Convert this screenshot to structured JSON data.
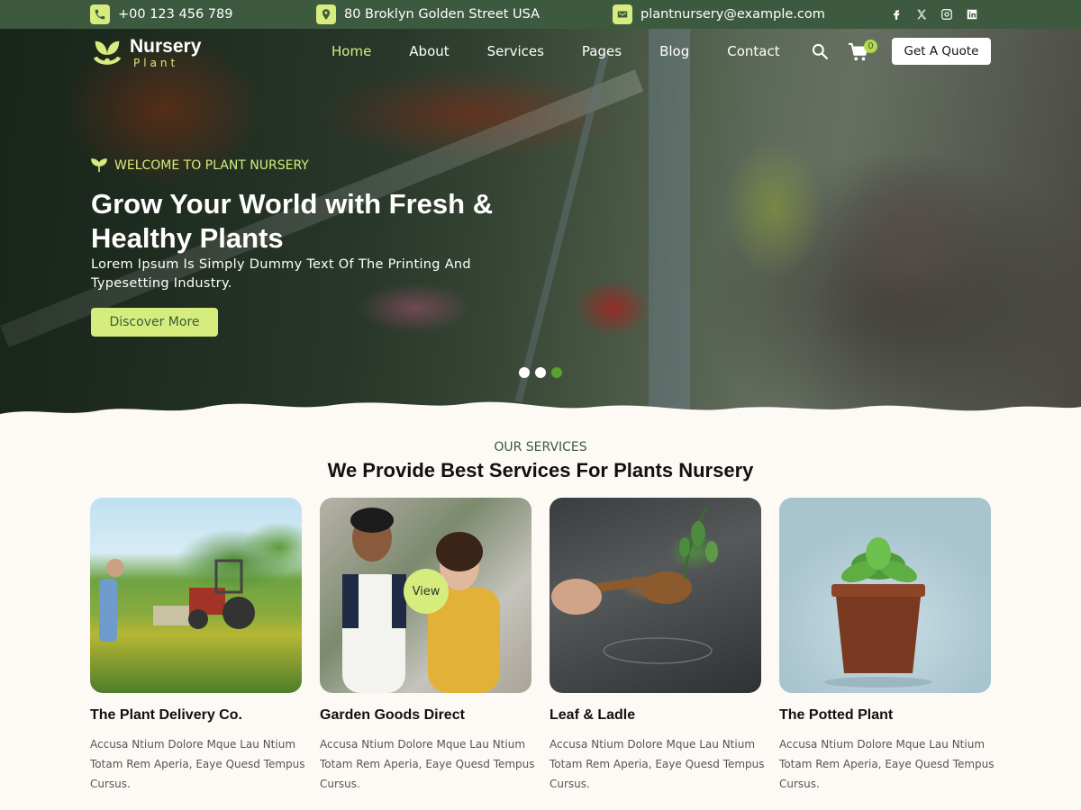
{
  "topbar": {
    "phone": "+00 123 456 789",
    "address": "80 Broklyn Golden Street USA",
    "email": "plantnursery@example.com",
    "socials": [
      "facebook-icon",
      "x-icon",
      "instagram-icon",
      "linkedin-icon"
    ]
  },
  "header": {
    "logo_line1": "Nursery",
    "logo_line2": "Plant",
    "nav": [
      "Home",
      "About",
      "Services",
      "Pages",
      "Blog",
      "Contact"
    ],
    "active_nav": "Home",
    "cart_count": "0",
    "quote_label": "Get A Quote"
  },
  "hero": {
    "eyebrow": "WELCOME TO PLANT NURSERY",
    "title": "Grow Your World with Fresh & Healthy Plants",
    "subtitle": "Lorem Ipsum Is Simply Dummy Text Of The Printing And Typesetting Industry.",
    "cta": "Discover More",
    "slides": 3,
    "active_slide": 3
  },
  "services": {
    "eyebrow": "OUR SERVICES",
    "title": "We Provide Best Services For  Plants Nursery",
    "view_label": "View",
    "cards": [
      {
        "title": "The Plant Delivery Co.",
        "text": "Accusa Ntium Dolore Mque Lau  Ntium Totam Rem Aperia, Eaye  Quesd Tempus Cursus."
      },
      {
        "title": "Garden Goods Direct",
        "text": "Accusa Ntium Dolore Mque Lau  Ntium Totam Rem Aperia, Eaye  Quesd Tempus Cursus."
      },
      {
        "title": "Leaf & Ladle",
        "text": "Accusa Ntium Dolore Mque Lau  Ntium Totam Rem Aperia, Eaye  Quesd Tempus Cursus."
      },
      {
        "title": "The Potted Plant",
        "text": "Accusa Ntium Dolore Mque Lau  Ntium Totam Rem Aperia, Eaye  Quesd Tempus Cursus."
      }
    ]
  },
  "colors": {
    "primary": "#3d5a3e",
    "accent": "#d6ec7d",
    "dot_active": "#5aa02c",
    "background": "#fdfaf5"
  }
}
